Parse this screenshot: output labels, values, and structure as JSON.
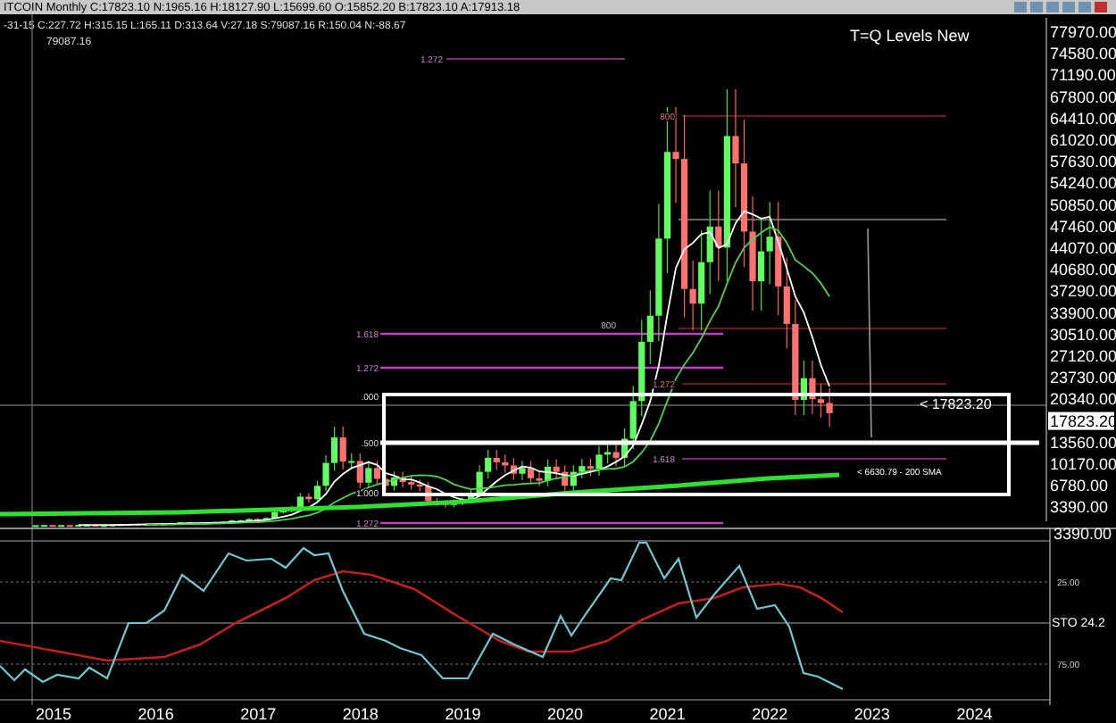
{
  "header": {
    "symbol_line": "ITCOIN Monthly C:17823.10 N:1965.16 H:18127.90 L:15699.60 O:15852.20 B:17823.10 A:17913.18"
  },
  "indicator_line": "-31-15 C:227.72 H:315.15 L:165.11 D:313.64 V:27.18 S:79087.16 R:150.04 N:-88.67",
  "marker_value": "79087.16",
  "chart_title": "T=Q Levels New",
  "price_axis": [
    {
      "label": "77970.00",
      "selected": false
    },
    {
      "label": "74580.00",
      "selected": false
    },
    {
      "label": "71190.00",
      "selected": false
    },
    {
      "label": "67800.00",
      "selected": false
    },
    {
      "label": "64410.00",
      "selected": false
    },
    {
      "label": "61020.00",
      "selected": false
    },
    {
      "label": "57630.00",
      "selected": false
    },
    {
      "label": "54240.00",
      "selected": false
    },
    {
      "label": "50850.00",
      "selected": false
    },
    {
      "label": "47460.00",
      "selected": false
    },
    {
      "label": "44070.00",
      "selected": false
    },
    {
      "label": "40680.00",
      "selected": false
    },
    {
      "label": "37290.00",
      "selected": false
    },
    {
      "label": "33900.00",
      "selected": false
    },
    {
      "label": "30510.00",
      "selected": false
    },
    {
      "label": "27120.00",
      "selected": false
    },
    {
      "label": "23730.00",
      "selected": false
    },
    {
      "label": "20340.00",
      "selected": false
    },
    {
      "label": "17823.20",
      "selected": true
    },
    {
      "label": "13560.00",
      "selected": false
    },
    {
      "label": "10170.00",
      "selected": false
    },
    {
      "label": "6780.00",
      "selected": false
    },
    {
      "label": "3390.00",
      "selected": false
    }
  ],
  "level_labels": [
    "1.272",
    "800",
    "1.618",
    "1.272",
    ".000",
    ".500",
    "1.000",
    "1.272",
    "800",
    "1.272",
    "1.618"
  ],
  "annotations": [
    "< 17823.20",
    "< 6630.79 - 200 SMA"
  ],
  "oscillator": {
    "top_label": "3390.00",
    "labels": [
      "25.00",
      "STO 24.2",
      "75.00"
    ]
  },
  "years": [
    "2015",
    "2016",
    "2017",
    "2018",
    "2019",
    "2020",
    "2021",
    "2022",
    "2023",
    "2024"
  ]
}
